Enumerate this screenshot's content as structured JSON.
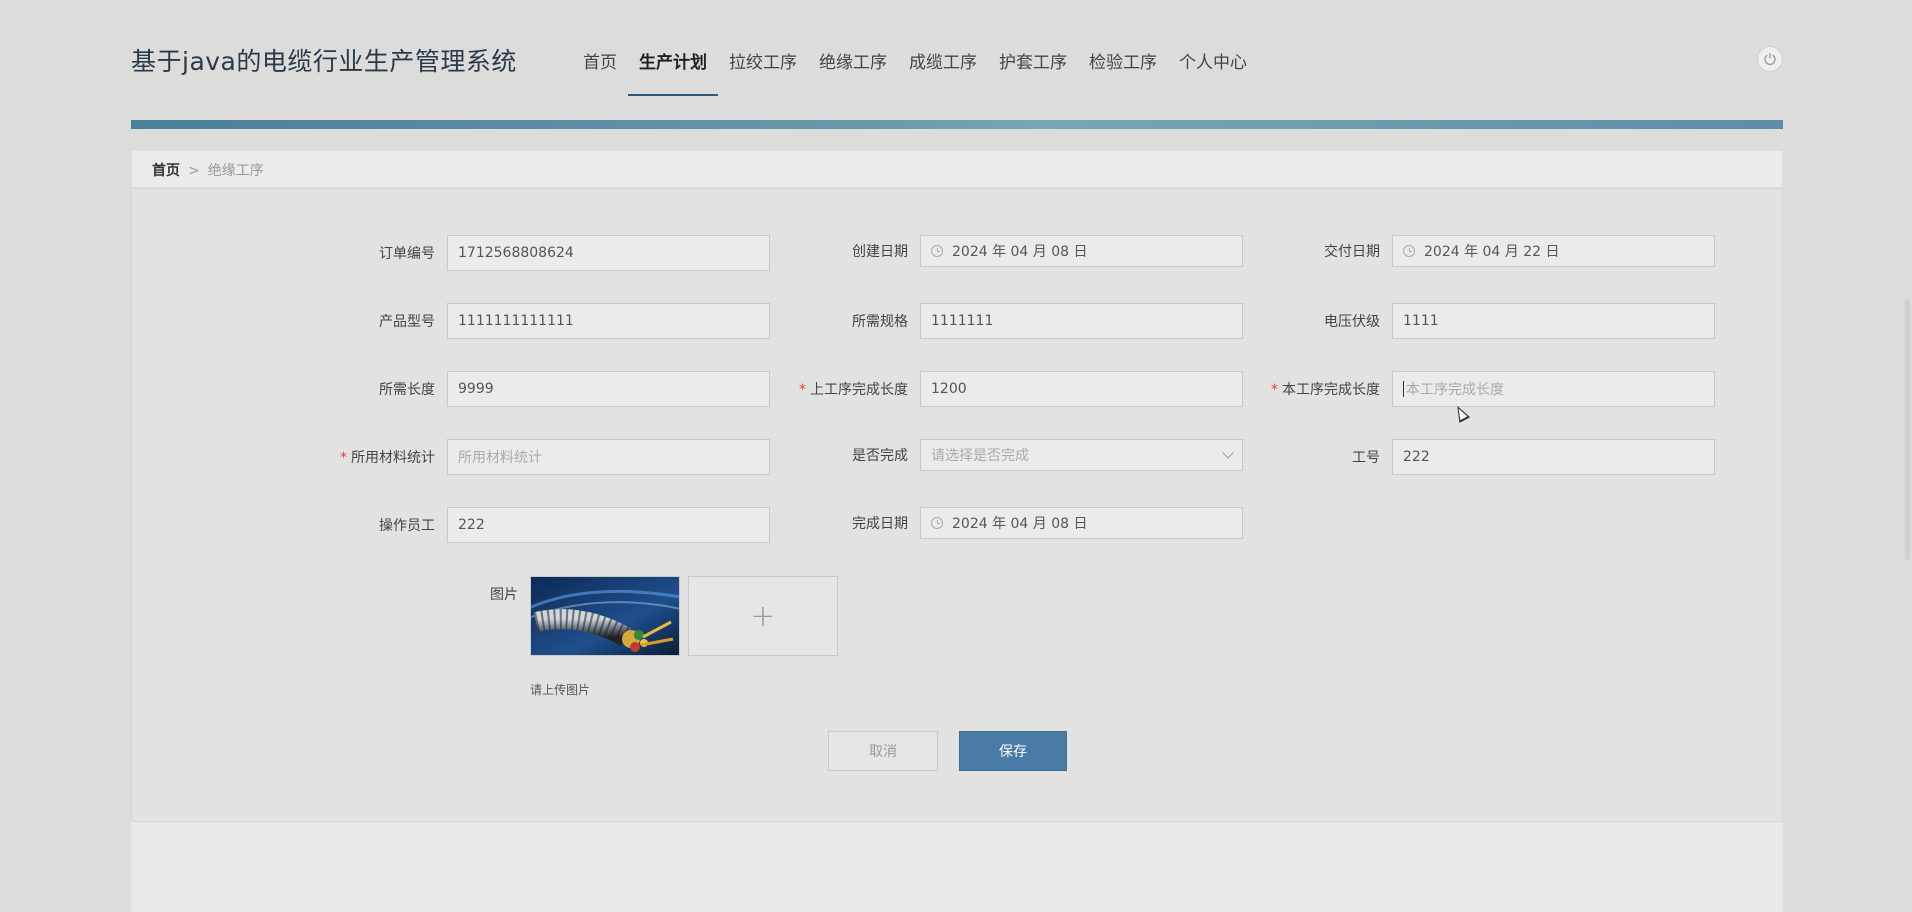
{
  "app": {
    "title": "基于java的电缆行业生产管理系统"
  },
  "nav": {
    "items": [
      {
        "label": "首页"
      },
      {
        "label": "生产计划"
      },
      {
        "label": "拉绞工序"
      },
      {
        "label": "绝缘工序"
      },
      {
        "label": "成缆工序"
      },
      {
        "label": "护套工序"
      },
      {
        "label": "检验工序"
      },
      {
        "label": "个人中心"
      }
    ],
    "active_index": 1
  },
  "breadcrumb": {
    "home": "首页",
    "separator": ">",
    "current": "绝缘工序"
  },
  "form": {
    "order_no": {
      "label": "订单编号",
      "value": "1712568808624"
    },
    "created_date": {
      "label": "创建日期",
      "value": "2024 年 04 月 08 日"
    },
    "delivery_date": {
      "label": "交付日期",
      "value": "2024 年 04 月 22 日"
    },
    "product_model": {
      "label": "产品型号",
      "value": "1111111111111"
    },
    "spec": {
      "label": "所需规格",
      "value": "1111111"
    },
    "voltage": {
      "label": "电压伏级",
      "value": "1111"
    },
    "length": {
      "label": "所需长度",
      "value": "9999"
    },
    "prev_done_length": {
      "label": "上工序完成长度",
      "value": "1200",
      "required": true
    },
    "cur_done_length": {
      "label": "本工序完成长度",
      "placeholder": "本工序完成长度",
      "required": true
    },
    "material_stats": {
      "label": "所用材料统计",
      "placeholder": "所用材料统计",
      "required": true
    },
    "completed": {
      "label": "是否完成",
      "placeholder": "请选择是否完成"
    },
    "work_no": {
      "label": "工号",
      "value": "222"
    },
    "operator": {
      "label": "操作员工",
      "value": "222"
    },
    "finish_date": {
      "label": "完成日期",
      "value": "2024 年 04 月 08 日"
    },
    "image": {
      "label": "图片",
      "upload_hint": "请上传图片",
      "plus": "+"
    },
    "required_mark": "*"
  },
  "buttons": {
    "cancel": "取消",
    "save": "保存"
  },
  "icons": {
    "power": "power-icon",
    "date": "clock-icon",
    "select": "chevron-down-icon",
    "upload": "plus-icon"
  },
  "colors": {
    "accent": "#4a7aa6",
    "bar": "#5d8ea6",
    "required": "#e0443c"
  }
}
